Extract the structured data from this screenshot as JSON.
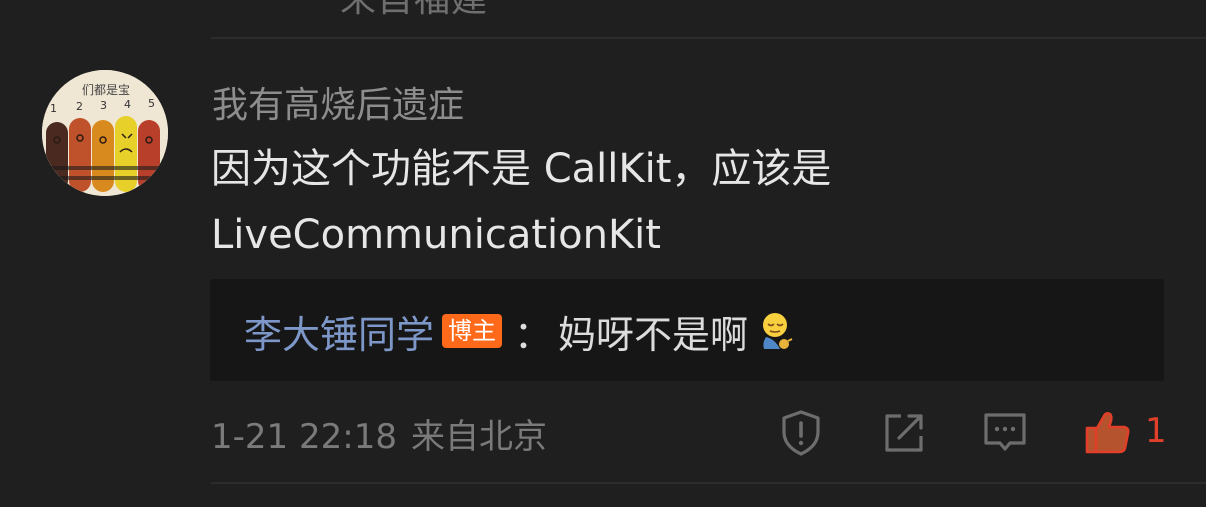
{
  "previous_comment": {
    "source_text": "来自福建"
  },
  "comment": {
    "username": "我有高烧后遗症",
    "text_line1": "因为这个功能不是 CallKit，应该是",
    "text_line2": "LiveCommunicationKit",
    "avatar_caption": "们都是宝",
    "avatar_numbers": [
      "1",
      "2",
      "3",
      "4",
      "5"
    ],
    "reply": {
      "author": "李大锤同学",
      "badge": "博主",
      "colon": "：",
      "text": "妈呀不是啊"
    },
    "time": "1-21 22:18",
    "location": "来自北京",
    "like_count": "1"
  },
  "icons": {
    "report": "report-shield-icon",
    "share": "share-icon",
    "comment": "comment-icon",
    "like": "thumbs-up-icon",
    "emoji": "facepalm-emoji"
  },
  "colors": {
    "background": "#1f1f1f",
    "reply_background": "#161616",
    "author_link": "#7d97c8",
    "badge": "#ff6a1a",
    "like_accent": "#e0402a"
  }
}
